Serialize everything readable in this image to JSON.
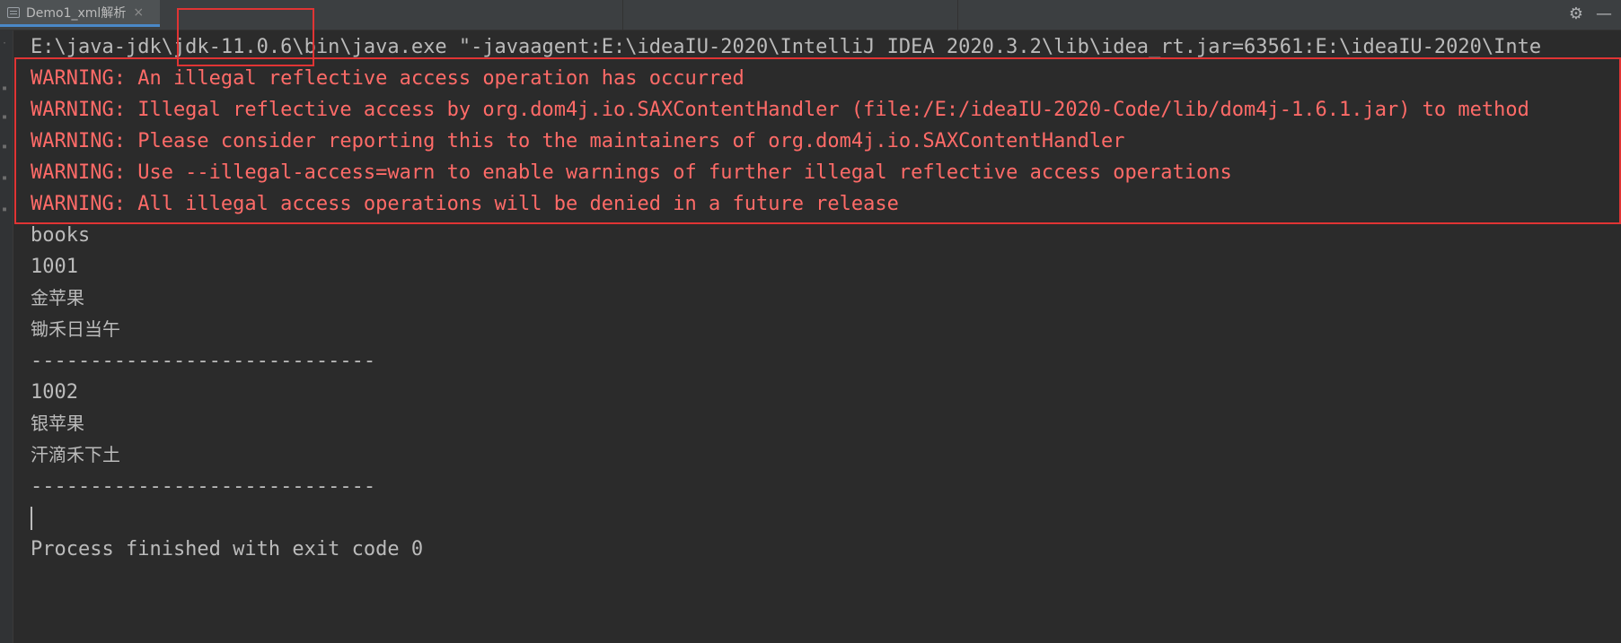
{
  "tab": {
    "title": "Demo1_xml解析",
    "close": "×"
  },
  "toolbar": {
    "settings_icon": "⚙",
    "minimize_icon": "—"
  },
  "console": {
    "command": "E:\\java-jdk\\jdk-11.0.6\\bin\\java.exe \"-javaagent:E:\\ideaIU-2020\\IntelliJ IDEA 2020.3.2\\lib\\idea_rt.jar=63561:E:\\ideaIU-2020\\Inte",
    "warnings": [
      "WARNING: An illegal reflective access operation has occurred",
      "WARNING: Illegal reflective access by org.dom4j.io.SAXContentHandler (file:/E:/ideaIU-2020-Code/lib/dom4j-1.6.1.jar) to method",
      "WARNING: Please consider reporting this to the maintainers of org.dom4j.io.SAXContentHandler",
      "WARNING: Use --illegal-access=warn to enable warnings of further illegal reflective access operations",
      "WARNING: All illegal access operations will be denied in a future release"
    ],
    "output": {
      "root": "books",
      "id1": "1001",
      "name1": "金苹果",
      "desc1": "锄禾日当午",
      "sep1": "-----------------------------",
      "id2": "1002",
      "name2": "银苹果",
      "desc2": "汗滴禾下土",
      "sep2": "-----------------------------"
    },
    "exit": "Process finished with exit code 0"
  },
  "colors": {
    "warning": "#ff6b68",
    "text": "#bbbbbb",
    "highlight": "#e03434",
    "background": "#2b2b2b"
  }
}
